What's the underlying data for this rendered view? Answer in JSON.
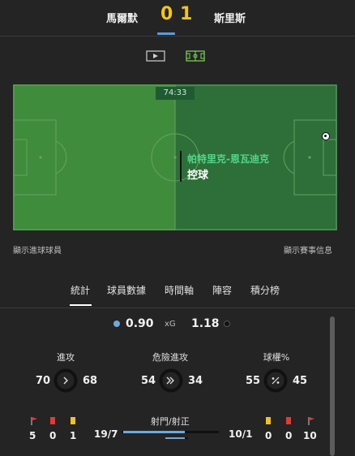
{
  "match": {
    "home_team": "馬爾默",
    "away_team": "斯里斯",
    "home_score": "0",
    "away_score": "1"
  },
  "toolbar": {
    "icons": [
      "video-icon",
      "pitch-view-icon"
    ]
  },
  "pitch": {
    "clock": "74:33",
    "player_name": "帕特里克-恩瓦迪克",
    "event": "控球"
  },
  "links": {
    "show_scorers": "顯示進球球員",
    "show_match_info": "顯示賽事信息"
  },
  "tabs": [
    "統計",
    "球員數據",
    "時間軸",
    "陣容",
    "積分榜"
  ],
  "active_tab": "統計",
  "xg": {
    "label": "xG",
    "home": "0.90",
    "away": "1.18"
  },
  "stats": [
    {
      "title": "進攻",
      "home": "70",
      "away": "68",
      "icon": "chevron-right-icon",
      "home_share": 0.507
    },
    {
      "title": "危險進攻",
      "home": "54",
      "away": "34",
      "icon": "double-chevron-right-icon",
      "home_share": 0.614
    },
    {
      "title": "球權%",
      "home": "55",
      "away": "45",
      "icon": "percent-icon",
      "home_share": 0.55
    }
  ],
  "counts": {
    "home": {
      "corners": "5",
      "red_cards": "0",
      "yellow_cards": "1"
    },
    "away": {
      "yellow_cards": "0",
      "red_cards": "0",
      "corners": "10"
    }
  },
  "shots": {
    "label": "射門/射正",
    "home": "19/7",
    "away": "10/1"
  },
  "colors": {
    "home": "#6fa8dc",
    "away": "#111111",
    "score": "#f5c518",
    "pitch_left": "#3f8c3c",
    "pitch_right": "#2e6e38",
    "highlight_name": "#4fd68a"
  }
}
